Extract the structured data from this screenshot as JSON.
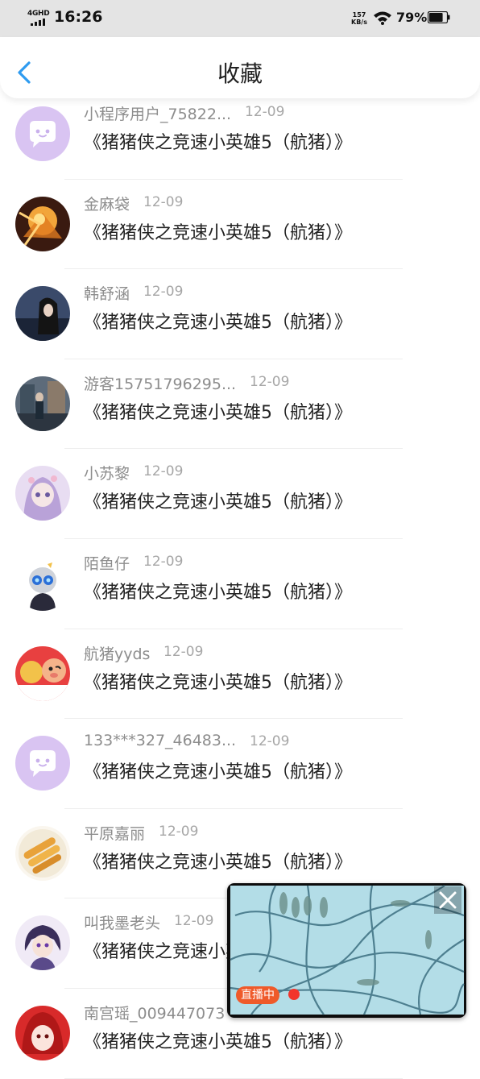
{
  "status_bar": {
    "network": "4GHD",
    "time": "16:26",
    "speed_value": "157",
    "speed_unit": "KB/s",
    "battery_percent": "79%",
    "battery_level": 0.79
  },
  "header": {
    "back_icon": "chevron-left-icon",
    "title": "收藏",
    "accent_color": "#2e9bf0"
  },
  "items": [
    {
      "name": "小程序用户_75822...",
      "date": "12-09",
      "title": "《猪猪侠之竞速小英雄5（航猪）》",
      "avatar": "default-chat-avatar"
    },
    {
      "name": "金麻袋",
      "date": "12-09",
      "title": "《猪猪侠之竞速小英雄5（航猪）》",
      "avatar": "anime-gold-avatar"
    },
    {
      "name": "韩舒涵",
      "date": "12-09",
      "title": "《猪猪侠之竞速小英雄5（航猪）》",
      "avatar": "photo-girl-avatar"
    },
    {
      "name": "游客15751796295...",
      "date": "12-09",
      "title": "《猪猪侠之竞速小英雄5（航猪）》",
      "avatar": "street-photo-avatar"
    },
    {
      "name": "小苏黎",
      "date": "12-09",
      "title": "《猪猪侠之竞速小英雄5（航猪）》",
      "avatar": "anime-purple-avatar"
    },
    {
      "name": "陌鱼仔",
      "date": "12-09",
      "title": "《猪猪侠之竞速小英雄5（航猪）》",
      "avatar": "chibi-robot-avatar"
    },
    {
      "name": "航猪yyds",
      "date": "12-09",
      "title": "《猪猪侠之竞速小英雄5（航猪）》",
      "avatar": "cartoon-pig-avatar"
    },
    {
      "name": "133***327_46483...",
      "date": "12-09",
      "title": "《猪猪侠之竞速小英雄5（航猪）》",
      "avatar": "default-chat-avatar"
    },
    {
      "name": "平原嘉丽",
      "date": "12-09",
      "title": "《猪猪侠之竞速小英雄5（航猪）》",
      "avatar": "food-avatar"
    },
    {
      "name": "叫我墨老头",
      "date": "12-09",
      "title": "《猪猪侠之竞速小英雄5（航猪）》",
      "avatar": "anime-boy-avatar"
    },
    {
      "name": "南宫瑶_009447073",
      "date": "12-09",
      "title": "《猪猪侠之竞速小英雄5（航猪）》",
      "avatar": "red-anime-avatar"
    }
  ],
  "live_window": {
    "badge": "直播中",
    "close_icon": "close-icon"
  }
}
